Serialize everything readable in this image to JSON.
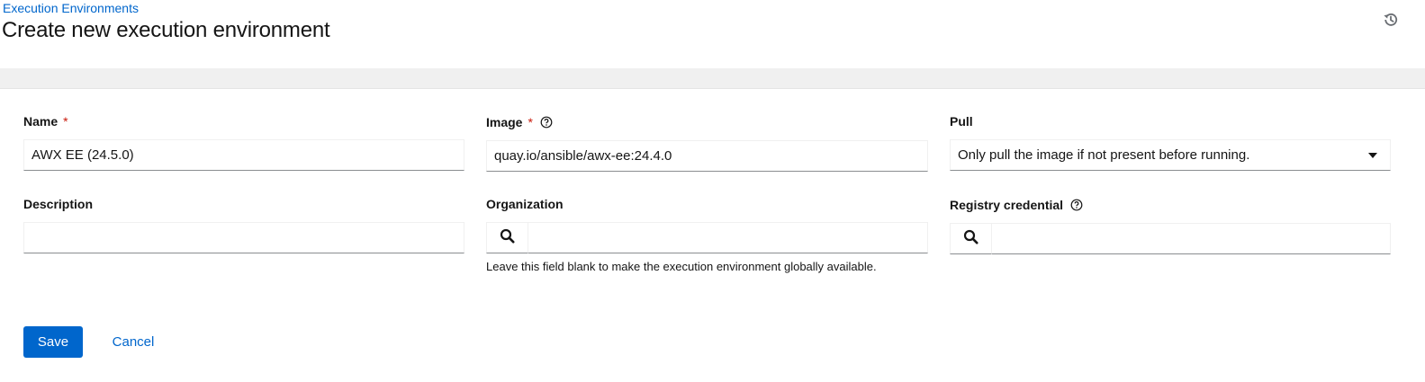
{
  "breadcrumb": {
    "parent": "Execution Environments"
  },
  "page": {
    "title": "Create new execution environment"
  },
  "form": {
    "name": {
      "label": "Name",
      "required_mark": "*",
      "value": "AWX EE (24.5.0)"
    },
    "image": {
      "label": "Image",
      "required_mark": "*",
      "value": "quay.io/ansible/awx-ee:24.4.0"
    },
    "pull": {
      "label": "Pull",
      "selected": "Only pull the image if not present before running."
    },
    "description": {
      "label": "Description",
      "value": ""
    },
    "organization": {
      "label": "Organization",
      "value": "",
      "helper": "Leave this field blank to make the execution environment globally available."
    },
    "registry_credential": {
      "label": "Registry credential",
      "value": ""
    }
  },
  "actions": {
    "save": "Save",
    "cancel": "Cancel"
  },
  "colors": {
    "link": "#0066cc",
    "primary_button": "#0066cc",
    "required": "#c9190b"
  }
}
